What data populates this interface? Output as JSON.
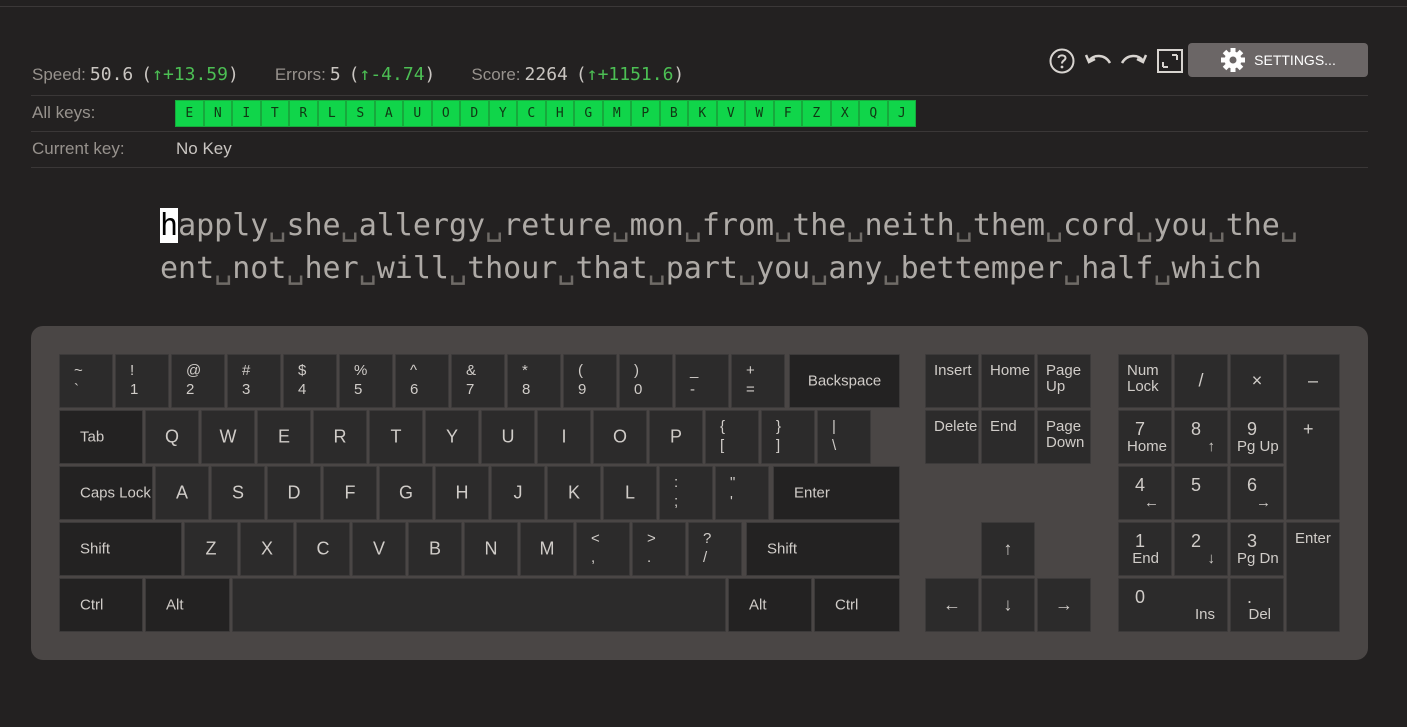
{
  "toolbar": {
    "help_icon": "help-circle-icon",
    "undo_icon": "undo-icon",
    "redo_icon": "redo-icon",
    "fullscreen_icon": "fullscreen-icon",
    "settings_label": "SETTINGS..."
  },
  "stats": {
    "speed_label": "Speed:",
    "speed_value": "50.6",
    "speed_delta": "+13.59",
    "errors_label": "Errors:",
    "errors_value": "5",
    "errors_delta": "-4.74",
    "score_label": "Score:",
    "score_value": "2264",
    "score_delta": "+1151.6",
    "open_paren": "(",
    "close_paren": ")",
    "arrow": "↑"
  },
  "all_keys": {
    "label": "All keys:",
    "keys": [
      "E",
      "N",
      "I",
      "T",
      "R",
      "L",
      "S",
      "A",
      "U",
      "O",
      "D",
      "Y",
      "C",
      "H",
      "G",
      "M",
      "P",
      "B",
      "K",
      "V",
      "W",
      "F",
      "Z",
      "X",
      "Q",
      "J"
    ]
  },
  "current_key": {
    "label": "Current key:",
    "value": "No Key"
  },
  "lesson": {
    "cursor_char": "h",
    "line1_rest": "apply␣she␣allergy␣reture␣mon␣from␣the␣neith␣them␣cord␣you␣the␣",
    "line2": "ent␣not␣her␣will␣thour␣that␣part␣you␣any␣bettemper␣half␣which"
  },
  "keyboard": {
    "row1": [
      [
        "~",
        "`"
      ],
      [
        "!",
        "1"
      ],
      [
        "@",
        "2"
      ],
      [
        "#",
        "3"
      ],
      [
        "$",
        "4"
      ],
      [
        "%",
        "5"
      ],
      [
        "^",
        "6"
      ],
      [
        "&",
        "7"
      ],
      [
        "*",
        "8"
      ],
      [
        "(",
        "9"
      ],
      [
        ")",
        "0"
      ],
      [
        "_",
        "-"
      ],
      [
        "+",
        "="
      ]
    ],
    "backspace": "Backspace",
    "tab": "Tab",
    "row2": [
      "Q",
      "W",
      "E",
      "R",
      "T",
      "Y",
      "U",
      "I",
      "O",
      "P"
    ],
    "row2_sym": [
      [
        "{",
        "["
      ],
      [
        "}",
        "]"
      ],
      [
        "|",
        "\\"
      ]
    ],
    "caps": "Caps Lock",
    "row3": [
      "A",
      "S",
      "D",
      "F",
      "G",
      "H",
      "J",
      "K",
      "L"
    ],
    "row3_sym": [
      [
        ":",
        ";"
      ],
      [
        "\"",
        "'"
      ]
    ],
    "enter": "Enter",
    "shift": "Shift",
    "row4": [
      "Z",
      "X",
      "C",
      "V",
      "B",
      "N",
      "M"
    ],
    "row4_sym": [
      [
        "<",
        ","
      ],
      [
        ">",
        "."
      ],
      [
        "?",
        "/"
      ]
    ],
    "ctrl": "Ctrl",
    "alt": "Alt",
    "nav": {
      "insert": "Insert",
      "home": "Home",
      "page_up": "Page\nUp",
      "delete": "Delete",
      "end": "End",
      "page_down": "Page\nDown",
      "up": "↑",
      "left": "←",
      "down": "↓",
      "right": "→"
    },
    "numpad": {
      "numlock": "Num\nLock",
      "div": "/",
      "mul": "×",
      "minus": "–",
      "plus": "+",
      "enter": "Enter",
      "n7": "7",
      "n7s": "Home",
      "n8": "8",
      "n8s": "↑",
      "n9": "9",
      "n9s": "Pg Up",
      "n4": "4",
      "n4s": "←",
      "n5": "5",
      "n6": "6",
      "n6s": "→",
      "n1": "1",
      "n1s": "End",
      "n2": "2",
      "n2s": "↓",
      "n3": "3",
      "n3s": "Pg Dn",
      "n0": "0",
      "n0s": "Ins",
      "dot": ".",
      "dots": "Del"
    }
  }
}
